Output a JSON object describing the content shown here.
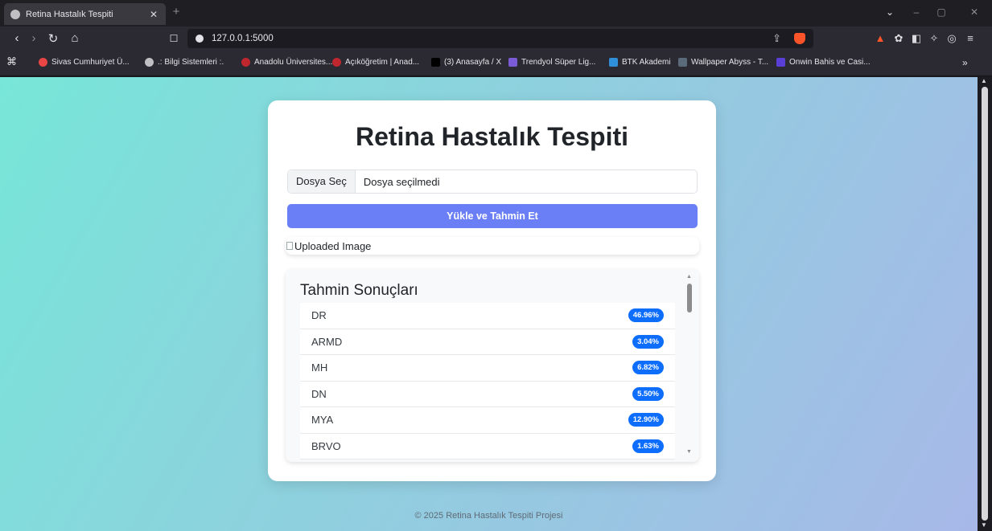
{
  "browser": {
    "tab_title": "Retina Hastalık Tespiti",
    "tab_close": "✕",
    "new_tab": "+",
    "url": "127.0.0.1:5000",
    "bookmarks": [
      {
        "label": "Sivas Cumhuriyet Ü...",
        "color": "#e94545"
      },
      {
        "label": ".: Bilgi Sistemleri :.",
        "color": "#bfbfc4"
      },
      {
        "label": "Anadolu Üniversites...",
        "color": "#c0262d"
      },
      {
        "label": "Açıköğretim | Anad...",
        "color": "#c0262d"
      },
      {
        "label": "(3) Anasayfa / X",
        "color": "#000000"
      },
      {
        "label": "Trendyol Süper Lig...",
        "color": "#7b5bd6"
      },
      {
        "label": "BTK Akademi",
        "color": "#2f8fd8"
      },
      {
        "label": "Wallpaper Abyss - T...",
        "color": "#5a6a7a"
      },
      {
        "label": "Onwin Bahis ve Casi...",
        "color": "#5a3fd6"
      }
    ],
    "bookmarks_more": "»"
  },
  "page": {
    "title": "Retina Hastalık Tespiti",
    "file_button": "Dosya Seç",
    "file_status": "Dosya seçilmedi",
    "submit_label": "Yükle ve Tahmin Et",
    "image_alt": "Uploaded Image",
    "results_title": "Tahmin Sonuçları",
    "results": [
      {
        "label": "DR",
        "value": "46.96%"
      },
      {
        "label": "ARMD",
        "value": "3.04%"
      },
      {
        "label": "MH",
        "value": "6.82%"
      },
      {
        "label": "DN",
        "value": "5.50%"
      },
      {
        "label": "MYA",
        "value": "12.90%"
      },
      {
        "label": "BRVO",
        "value": "1.63%"
      }
    ],
    "footer": "© 2025 Retina Hastalık Tespiti Projesi"
  },
  "colors": {
    "accent_button": "#6a7ff5",
    "badge": "#0d6efd"
  }
}
